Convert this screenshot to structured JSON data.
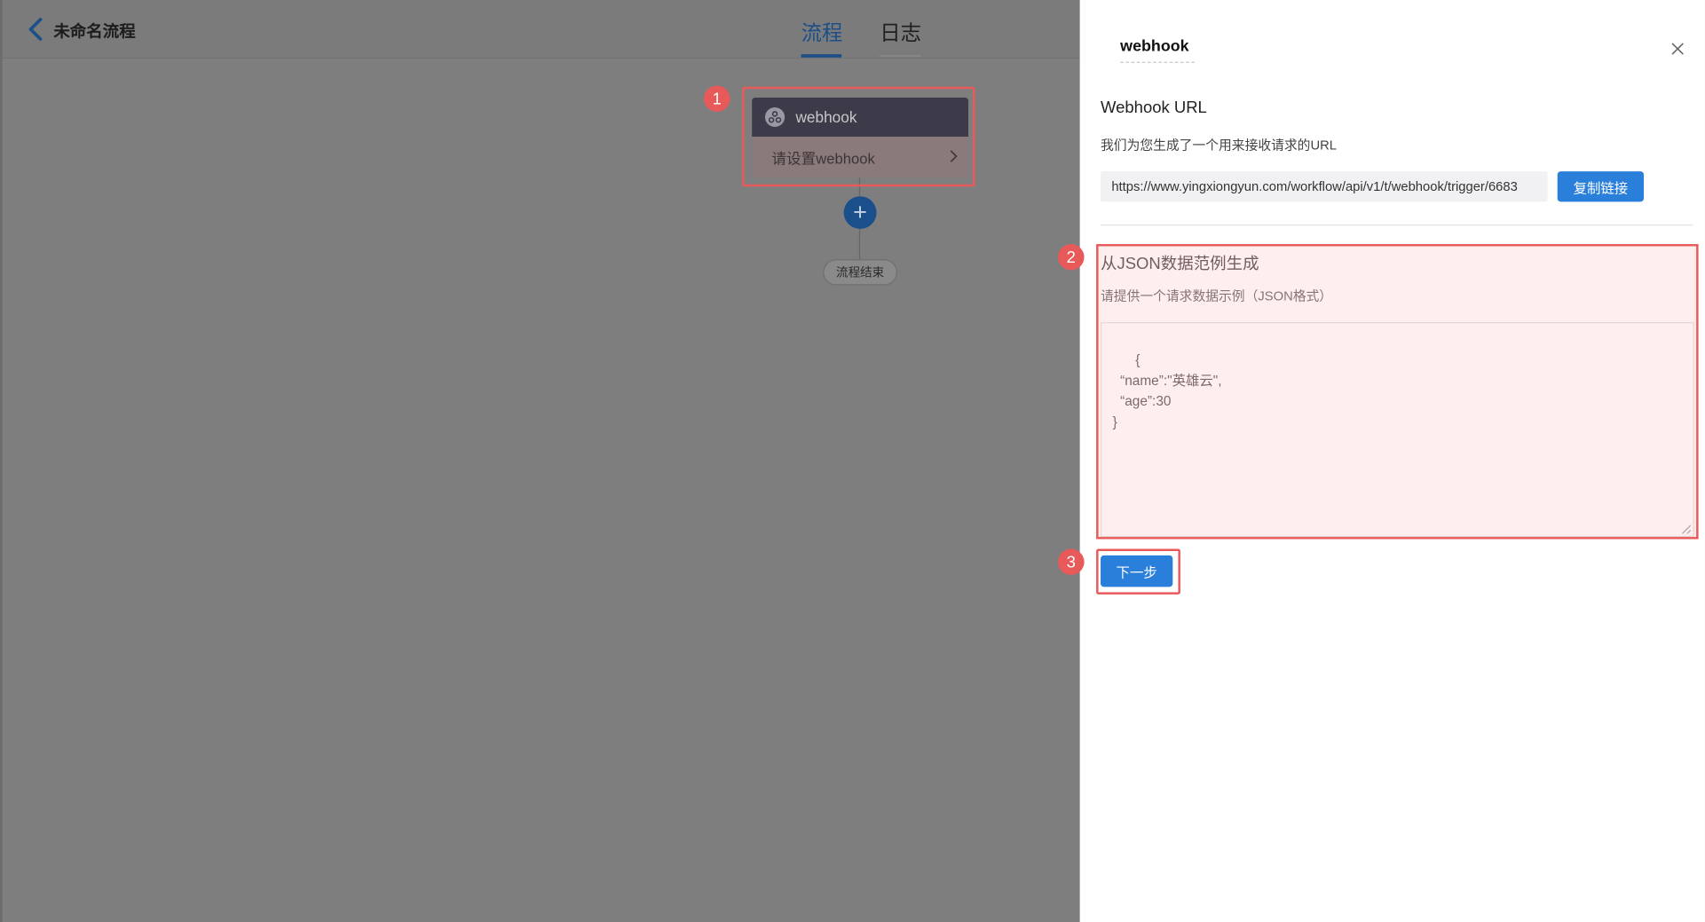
{
  "header": {
    "flow_title": "未命名流程",
    "tabs": [
      {
        "label": "流程",
        "active": true
      },
      {
        "label": "日志",
        "active": false
      }
    ]
  },
  "canvas": {
    "node": {
      "type_label": "webhook",
      "placeholder": "请设置webhook"
    },
    "end_label": "流程结束"
  },
  "panel": {
    "title": "webhook",
    "url_section": {
      "heading": "Webhook URL",
      "description": "我们为您生成了一个用来接收请求的URL",
      "url": "https://www.yingxiongyun.com/workflow/api/v1/t/webhook/trigger/6683",
      "copy_button": "复制链接"
    },
    "json_section": {
      "heading": "从JSON数据范例生成",
      "description": "请提供一个请求数据示例（JSON格式）",
      "sample": "{\n  “name”:\"英雄云\",\n  “age”:30\n}"
    },
    "next_button": "下一步"
  },
  "annotations": [
    "1",
    "2",
    "3"
  ],
  "colors": {
    "accent": "#2a7fdb",
    "annotation": "#e85a5a",
    "overlay": "#7e7e7f"
  }
}
